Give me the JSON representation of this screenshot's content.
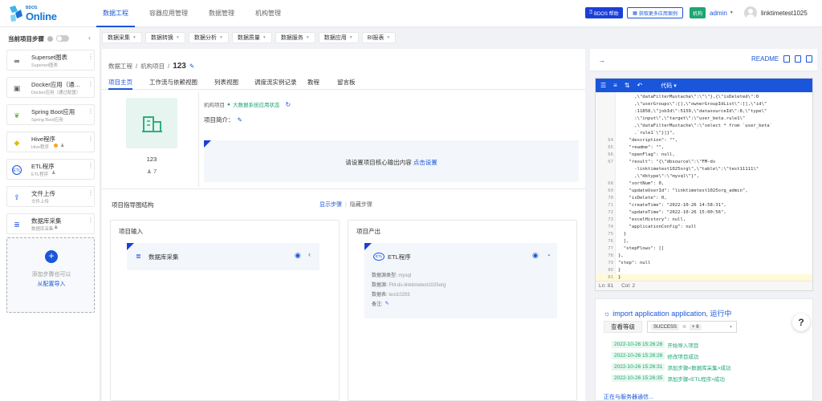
{
  "app": {
    "logo_small": "BDOS",
    "logo_big": "Online"
  },
  "topnav": [
    {
      "label": "数据工程",
      "active": true
    },
    {
      "label": "容器应用管理",
      "active": false
    },
    {
      "label": "数据管理",
      "active": false
    },
    {
      "label": "机构管理",
      "active": false
    }
  ],
  "header": {
    "help_label": "BDOS 帮助",
    "more_apps_label": "获取更多应用案例",
    "org_label": "机构",
    "admin_label": "admin",
    "username": "linktimetest1025"
  },
  "left_panel": {
    "title": "当前项目步骤",
    "steps": [
      {
        "title": "Superset图表",
        "subtitle": "Superset图表",
        "icon": "∞"
      },
      {
        "title": "Docker应用（通…",
        "subtitle": "Docker应用（通过配置）",
        "icon": "▣"
      },
      {
        "title": "Spring Boot应用",
        "subtitle": "Spring Boot应用",
        "icon": "❦"
      },
      {
        "title": "Hive程序",
        "subtitle": "Hive程序",
        "icon": "◆"
      },
      {
        "title": "ETL程序",
        "subtitle": "ETL程序",
        "icon": "ETL"
      },
      {
        "title": "文件上传",
        "subtitle": "文件上传",
        "icon": "⇪"
      },
      {
        "title": "数据库采集",
        "subtitle": "数据库采集",
        "icon": "≣"
      }
    ],
    "add_text": "添加步骤也可以",
    "add_link": "从配置导入"
  },
  "toolbar": [
    "数据采集",
    "数据转换",
    "数据分析",
    "数据质量",
    "数据服务",
    "数据应用",
    "BI报表"
  ],
  "breadcrumb": {
    "root": "数据工程",
    "mid": "机构项目",
    "current": "123"
  },
  "subtabs": [
    "项目主页",
    "工作流与依赖视图",
    "列表视图",
    "调度流实例记录",
    "教程",
    "留言板"
  ],
  "project": {
    "name": "123",
    "members": "7",
    "org_tag": "机构项目",
    "status": "大数据系统应用状态",
    "intro_label": "项目简介：",
    "output_text": "请设置项目核心输出内容",
    "output_link": "点击设置"
  },
  "guide": {
    "title": "项目指导图结构",
    "show": "显示步骤",
    "hide": "隐藏步骤"
  },
  "input_card": {
    "title": "项目输入",
    "item_name": "数据库采集"
  },
  "output_card": {
    "title": "项目产出",
    "item_name": "ETL程序",
    "icon_text": "ETL",
    "details": [
      {
        "label": "数据源类型:",
        "value": "mysql"
      },
      {
        "label": "数据源:",
        "value": "FM-ds-linktimetest1025org"
      },
      {
        "label": "数据表:",
        "value": "test10255"
      },
      {
        "label": "备注:",
        "value": ""
      }
    ]
  },
  "right_panel": {
    "readme_label": "README",
    "editor_mode": "代码",
    "code_lines": [
      {
        "n": "",
        "t": "      ,\\\"dataFilterMustache\\\":\\\"\\\"},{\\\"isDeleted\\\":0"
      },
      {
        "n": "",
        "t": "      ,\\\"userGroups\\\":[],\\\"ownerGroupIdList\\\":[],\\\"id\\\""
      },
      {
        "n": "",
        "t": "      :11858,\\\"jobId\\\":5159,\\\"datasourceId\\\":8,\\\"type\\\""
      },
      {
        "n": "",
        "t": "      :\\\"input\\\",\\\"target\\\":\\\"user_beta.rule1\\\""
      },
      {
        "n": "",
        "t": "      ,\\\"dataFilterMustache\\\":\\\"select * from `user_beta`"
      },
      {
        "n": "",
        "t": "      .`rule1`\\\"}]}\","
      },
      {
        "n": "64",
        "t": "    \"description\": \"\","
      },
      {
        "n": "65",
        "t": "    \"readme\": \"\","
      },
      {
        "n": "66",
        "t": "    \"openFlag\": null,"
      },
      {
        "n": "67",
        "t": "    \"result\": \"{\\\"dbsource\\\":\\\"FM-ds"
      },
      {
        "n": "",
        "t": "      -linktimetest1025org\\\",\\\"table\\\":\\\"test11111\\\""
      },
      {
        "n": "",
        "t": "      ,\\\"dbtype\\\":\\\"mysql\\\"}\","
      },
      {
        "n": "68",
        "t": "    \"sortNum\": 0,"
      },
      {
        "n": "69",
        "t": "    \"updateUserId\": \"linktimetest1025org_admin\","
      },
      {
        "n": "70",
        "t": "    \"isDelete\": 0,"
      },
      {
        "n": "71",
        "t": "    \"createTime\": \"2022-10-26 14:58:31\","
      },
      {
        "n": "72",
        "t": "    \"updateTime\": \"2022-10-26 15:00:56\","
      },
      {
        "n": "73",
        "t": "    \"excelHistory\": null,"
      },
      {
        "n": "74",
        "t": "    \"applicationConfig\": null"
      },
      {
        "n": "75",
        "t": "  }"
      },
      {
        "n": "76",
        "t": "  ],"
      },
      {
        "n": "77",
        "t": "  \"stepFlows\": []"
      },
      {
        "n": "78",
        "t": "},"
      },
      {
        "n": "79",
        "t": "\"step\": null"
      },
      {
        "n": "80",
        "t": "}"
      },
      {
        "n": "81",
        "t": "}"
      }
    ],
    "status_ln": "Ln: 81",
    "status_col": "Col: 2",
    "log_title": "import application application, 运行中",
    "log_level_label": "查看等级",
    "log_level_value": "SUCCESS",
    "log_level_extra": "+ 6",
    "logs": [
      {
        "ts": "2022-10-26 15:26:26",
        "msg": "开始导入项目"
      },
      {
        "ts": "2022-10-26 15:26:26",
        "msg": "修改项目成功"
      },
      {
        "ts": "2022-10-26 15:26:31",
        "msg": "添加步骤<数据库采集>成功"
      },
      {
        "ts": "2022-10-26 15:26:35",
        "msg": "添加步骤<ETL程序>成功"
      }
    ],
    "connecting": "正在与服务器通信..."
  },
  "colors": {
    "primary": "#1a56db",
    "success": "#1ba672",
    "help": "#1a3fd9"
  }
}
